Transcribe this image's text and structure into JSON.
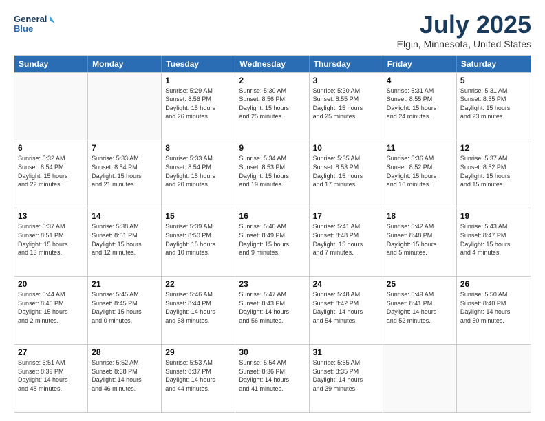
{
  "header": {
    "logo_line1": "General",
    "logo_line2": "Blue",
    "title": "July 2025",
    "subtitle": "Elgin, Minnesota, United States"
  },
  "days_of_week": [
    "Sunday",
    "Monday",
    "Tuesday",
    "Wednesday",
    "Thursday",
    "Friday",
    "Saturday"
  ],
  "weeks": [
    [
      {
        "day": "",
        "info": ""
      },
      {
        "day": "",
        "info": ""
      },
      {
        "day": "1",
        "info": "Sunrise: 5:29 AM\nSunset: 8:56 PM\nDaylight: 15 hours\nand 26 minutes."
      },
      {
        "day": "2",
        "info": "Sunrise: 5:30 AM\nSunset: 8:56 PM\nDaylight: 15 hours\nand 25 minutes."
      },
      {
        "day": "3",
        "info": "Sunrise: 5:30 AM\nSunset: 8:55 PM\nDaylight: 15 hours\nand 25 minutes."
      },
      {
        "day": "4",
        "info": "Sunrise: 5:31 AM\nSunset: 8:55 PM\nDaylight: 15 hours\nand 24 minutes."
      },
      {
        "day": "5",
        "info": "Sunrise: 5:31 AM\nSunset: 8:55 PM\nDaylight: 15 hours\nand 23 minutes."
      }
    ],
    [
      {
        "day": "6",
        "info": "Sunrise: 5:32 AM\nSunset: 8:54 PM\nDaylight: 15 hours\nand 22 minutes."
      },
      {
        "day": "7",
        "info": "Sunrise: 5:33 AM\nSunset: 8:54 PM\nDaylight: 15 hours\nand 21 minutes."
      },
      {
        "day": "8",
        "info": "Sunrise: 5:33 AM\nSunset: 8:54 PM\nDaylight: 15 hours\nand 20 minutes."
      },
      {
        "day": "9",
        "info": "Sunrise: 5:34 AM\nSunset: 8:53 PM\nDaylight: 15 hours\nand 19 minutes."
      },
      {
        "day": "10",
        "info": "Sunrise: 5:35 AM\nSunset: 8:53 PM\nDaylight: 15 hours\nand 17 minutes."
      },
      {
        "day": "11",
        "info": "Sunrise: 5:36 AM\nSunset: 8:52 PM\nDaylight: 15 hours\nand 16 minutes."
      },
      {
        "day": "12",
        "info": "Sunrise: 5:37 AM\nSunset: 8:52 PM\nDaylight: 15 hours\nand 15 minutes."
      }
    ],
    [
      {
        "day": "13",
        "info": "Sunrise: 5:37 AM\nSunset: 8:51 PM\nDaylight: 15 hours\nand 13 minutes."
      },
      {
        "day": "14",
        "info": "Sunrise: 5:38 AM\nSunset: 8:51 PM\nDaylight: 15 hours\nand 12 minutes."
      },
      {
        "day": "15",
        "info": "Sunrise: 5:39 AM\nSunset: 8:50 PM\nDaylight: 15 hours\nand 10 minutes."
      },
      {
        "day": "16",
        "info": "Sunrise: 5:40 AM\nSunset: 8:49 PM\nDaylight: 15 hours\nand 9 minutes."
      },
      {
        "day": "17",
        "info": "Sunrise: 5:41 AM\nSunset: 8:48 PM\nDaylight: 15 hours\nand 7 minutes."
      },
      {
        "day": "18",
        "info": "Sunrise: 5:42 AM\nSunset: 8:48 PM\nDaylight: 15 hours\nand 5 minutes."
      },
      {
        "day": "19",
        "info": "Sunrise: 5:43 AM\nSunset: 8:47 PM\nDaylight: 15 hours\nand 4 minutes."
      }
    ],
    [
      {
        "day": "20",
        "info": "Sunrise: 5:44 AM\nSunset: 8:46 PM\nDaylight: 15 hours\nand 2 minutes."
      },
      {
        "day": "21",
        "info": "Sunrise: 5:45 AM\nSunset: 8:45 PM\nDaylight: 15 hours\nand 0 minutes."
      },
      {
        "day": "22",
        "info": "Sunrise: 5:46 AM\nSunset: 8:44 PM\nDaylight: 14 hours\nand 58 minutes."
      },
      {
        "day": "23",
        "info": "Sunrise: 5:47 AM\nSunset: 8:43 PM\nDaylight: 14 hours\nand 56 minutes."
      },
      {
        "day": "24",
        "info": "Sunrise: 5:48 AM\nSunset: 8:42 PM\nDaylight: 14 hours\nand 54 minutes."
      },
      {
        "day": "25",
        "info": "Sunrise: 5:49 AM\nSunset: 8:41 PM\nDaylight: 14 hours\nand 52 minutes."
      },
      {
        "day": "26",
        "info": "Sunrise: 5:50 AM\nSunset: 8:40 PM\nDaylight: 14 hours\nand 50 minutes."
      }
    ],
    [
      {
        "day": "27",
        "info": "Sunrise: 5:51 AM\nSunset: 8:39 PM\nDaylight: 14 hours\nand 48 minutes."
      },
      {
        "day": "28",
        "info": "Sunrise: 5:52 AM\nSunset: 8:38 PM\nDaylight: 14 hours\nand 46 minutes."
      },
      {
        "day": "29",
        "info": "Sunrise: 5:53 AM\nSunset: 8:37 PM\nDaylight: 14 hours\nand 44 minutes."
      },
      {
        "day": "30",
        "info": "Sunrise: 5:54 AM\nSunset: 8:36 PM\nDaylight: 14 hours\nand 41 minutes."
      },
      {
        "day": "31",
        "info": "Sunrise: 5:55 AM\nSunset: 8:35 PM\nDaylight: 14 hours\nand 39 minutes."
      },
      {
        "day": "",
        "info": ""
      },
      {
        "day": "",
        "info": ""
      }
    ]
  ]
}
